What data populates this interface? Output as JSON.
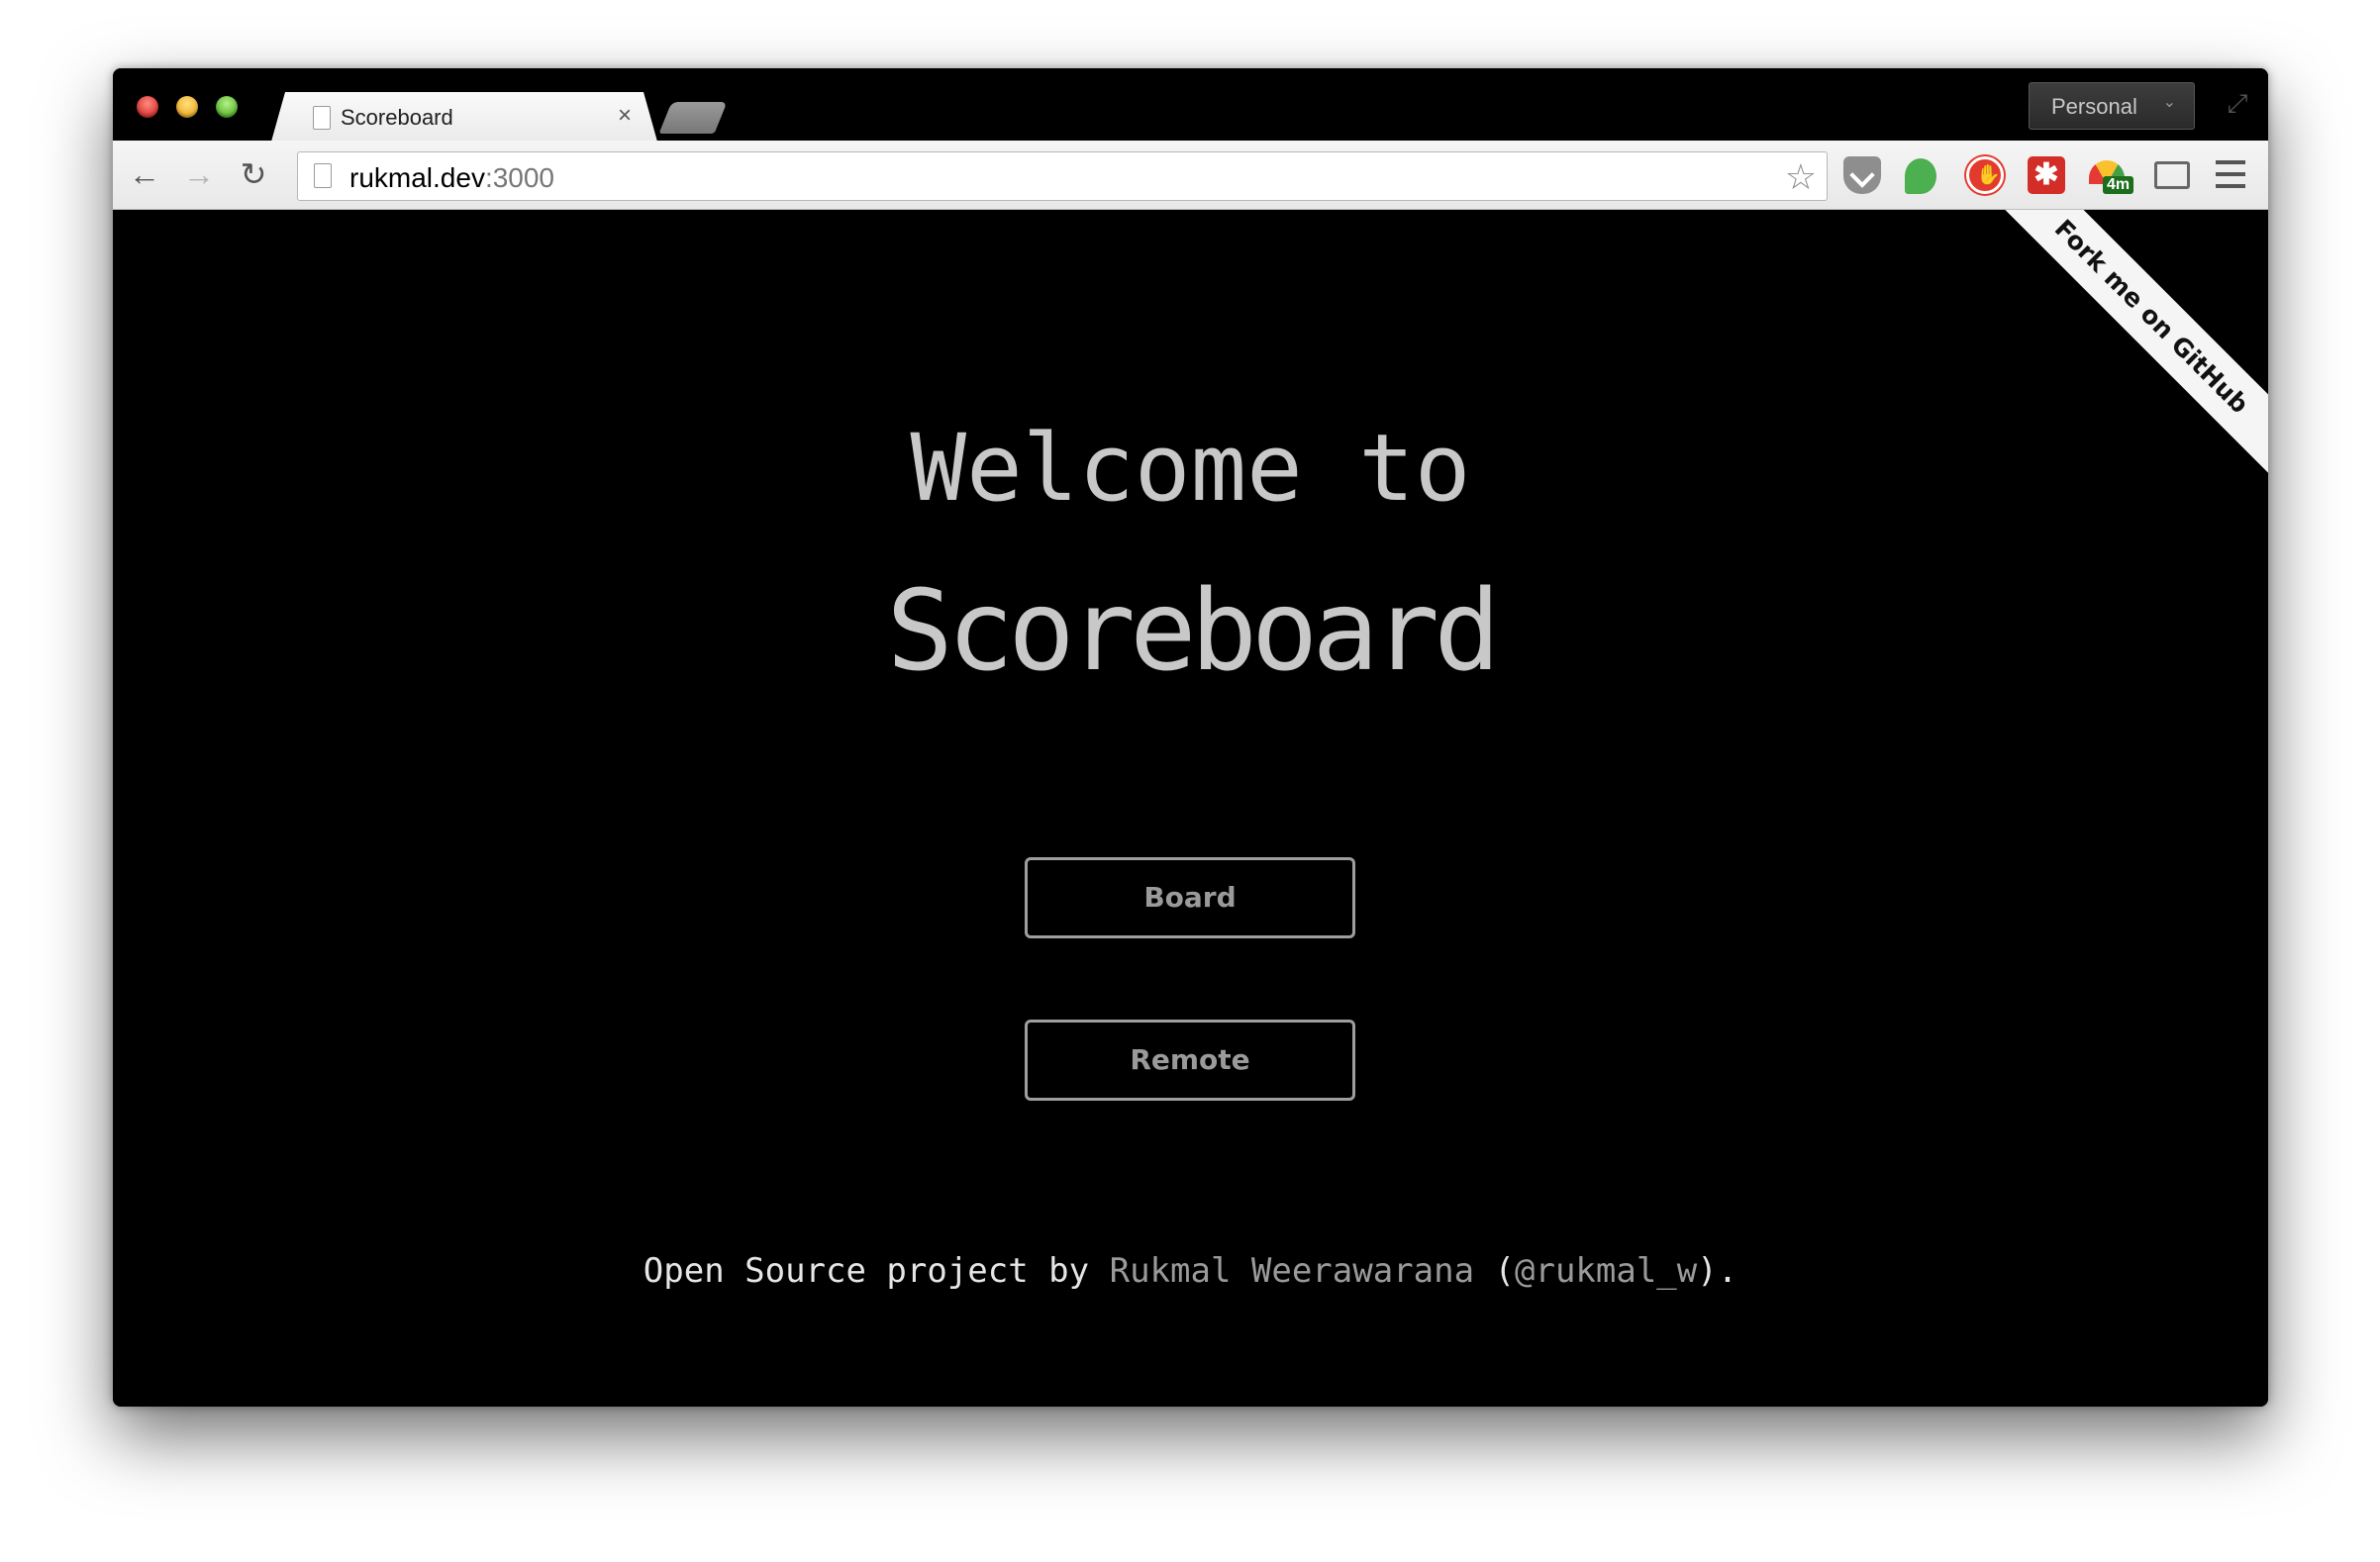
{
  "browser": {
    "tab": {
      "title": "Scoreboard",
      "close_glyph": "×",
      "icon": "document-icon"
    },
    "profile": {
      "label": "Personal",
      "caret": "⌄"
    },
    "fullscreen_glyph": "⤢",
    "nav": {
      "back_glyph": "←",
      "forward_glyph": "→",
      "reload_glyph": "↻"
    },
    "address": {
      "host": "rukmal.dev",
      "port": ":3000",
      "star_glyph": "☆"
    },
    "extensions": [
      {
        "name": "pocket-icon"
      },
      {
        "name": "evernote-icon"
      },
      {
        "name": "stop-hand-icon"
      },
      {
        "name": "lastpass-icon",
        "glyph": "✱"
      },
      {
        "name": "weather-icon",
        "badge": "4m"
      },
      {
        "name": "cast-icon"
      },
      {
        "name": "menu-icon"
      }
    ]
  },
  "page": {
    "heading_line1": "Welcome to",
    "heading_line2": "Scoreboard",
    "buttons": {
      "board": "Board",
      "remote": "Remote"
    },
    "footer": {
      "prefix": "Open Source project by ",
      "author": "Rukmal Weerawarana",
      "open_paren": " (",
      "handle": "@rukmal_w",
      "suffix": ")."
    },
    "ribbon": "Fork me on GitHub"
  },
  "colors": {
    "page_background": "#000000",
    "heading": "#c8c8c8",
    "button_border": "#9e9e9e",
    "link": "#9a9a9a"
  }
}
